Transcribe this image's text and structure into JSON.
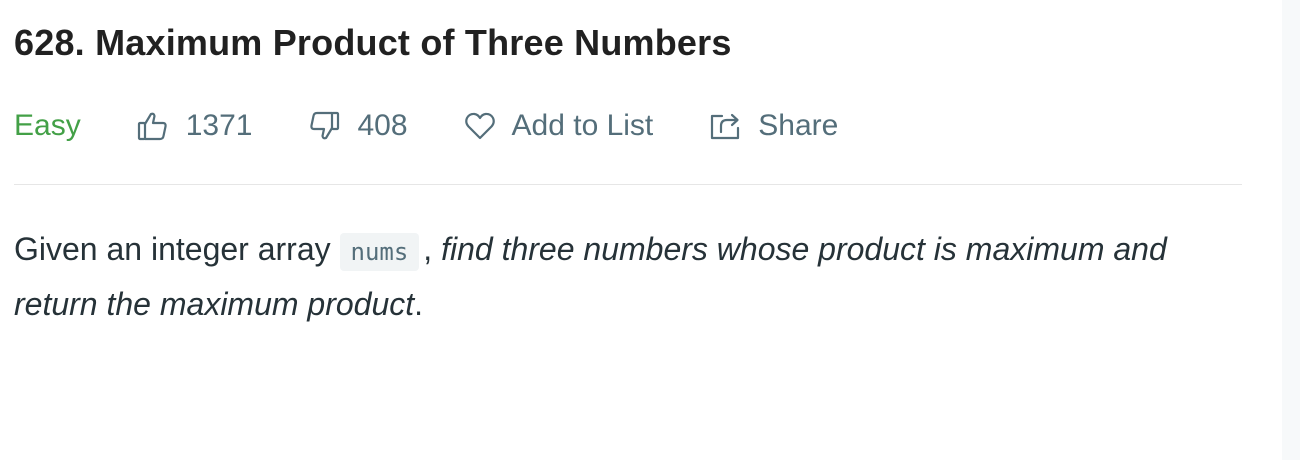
{
  "problem": {
    "title": "628. Maximum Product of Three Numbers",
    "difficulty": "Easy",
    "likes": "1371",
    "dislikes": "408",
    "add_to_list_label": "Add to List",
    "share_label": "Share"
  },
  "description": {
    "intro": "Given an integer array ",
    "code": "nums",
    "comma": ", ",
    "italic_1": "find three numbers whose product is maximum and return the maximum product",
    "end": "."
  },
  "colors": {
    "difficulty_easy": "#43a047",
    "meta_text": "#546e7a",
    "title": "#212121",
    "divider": "#e6e6e6",
    "code_bg": "#f1f4f5"
  },
  "icons": [
    "thumbs-up-icon",
    "thumbs-down-icon",
    "heart-icon",
    "share-icon"
  ]
}
